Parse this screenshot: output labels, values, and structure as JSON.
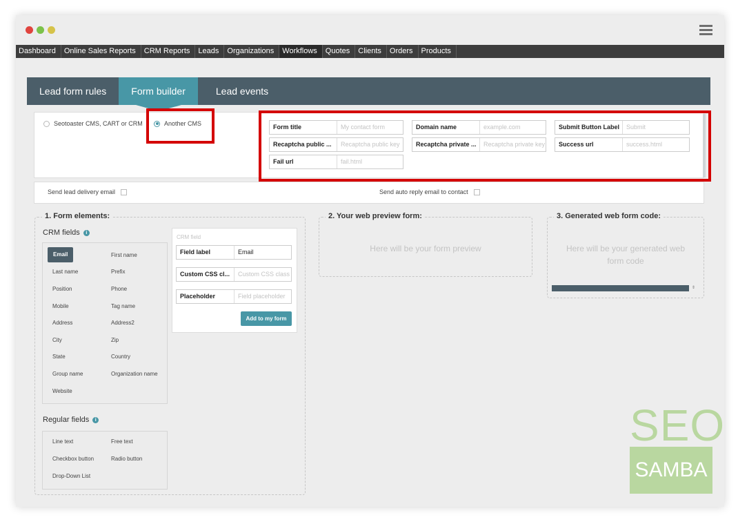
{
  "nav": [
    "Dashboard",
    "Online Sales Reports",
    "CRM Reports",
    "Leads",
    "Organizations",
    "Workflows",
    "Quotes",
    "Clients",
    "Orders",
    "Products"
  ],
  "tabs": [
    "Lead form rules",
    "Form builder",
    "Lead events"
  ],
  "cms_options": {
    "opt1": "Seotoaster CMS, CART or CRM",
    "opt2": "Another CMS",
    "selected": "Another CMS"
  },
  "form_fields": {
    "form_title": {
      "label": "Form title",
      "placeholder": "My contact form"
    },
    "domain_name": {
      "label": "Domain name",
      "placeholder": "example.com"
    },
    "submit_label": {
      "label": "Submit Button Label",
      "placeholder": "Submit"
    },
    "recaptcha_public": {
      "label": "Recaptcha public ...",
      "placeholder": "Recaptcha public key"
    },
    "recaptcha_private": {
      "label": "Recaptcha private ...",
      "placeholder": "Recaptcha private key"
    },
    "success_url": {
      "label": "Success url",
      "placeholder": "success.html"
    },
    "fail_url": {
      "label": "Fail url",
      "placeholder": "fail.html"
    }
  },
  "send_options": {
    "lead_delivery": "Send lead delivery email",
    "auto_reply": "Send auto reply email to contact"
  },
  "sections": {
    "form_elements": "1. Form elements:",
    "preview": "2. Your web preview form:",
    "code": "3. Generated web form code:"
  },
  "crm_fields_label": "CRM fields",
  "crm_fields": [
    "Email",
    "First name",
    "Last name",
    "Prefix",
    "Position",
    "Phone",
    "Mobile",
    "Tag name",
    "Address",
    "Address2",
    "City",
    "Zip",
    "State",
    "Country",
    "Group name",
    "Organization name",
    "Website"
  ],
  "crm_panel": {
    "header": "CRM field",
    "field_label": "Field label",
    "field_label_value": "Email",
    "css_class": "Custom CSS cl...",
    "css_class_placeholder": "Custom CSS class",
    "placeholder": "Placeholder",
    "placeholder_placeholder": "Field placeholder",
    "add_button": "Add to my form"
  },
  "regular_fields_label": "Regular fields",
  "regular_fields": [
    "Line text",
    "Free text",
    "Checkbox button",
    "Radio button",
    "Drop-Down List"
  ],
  "preview_placeholder": "Here will be your form preview",
  "code_placeholder": "Here will be your generated web form code",
  "logo": {
    "top": "SEO",
    "bottom": "SAMBA"
  },
  "colors": {
    "accent": "#4897a6",
    "tabbar": "#4b5e69",
    "highlight": "#d40000",
    "logo": "#b9d7a0"
  }
}
